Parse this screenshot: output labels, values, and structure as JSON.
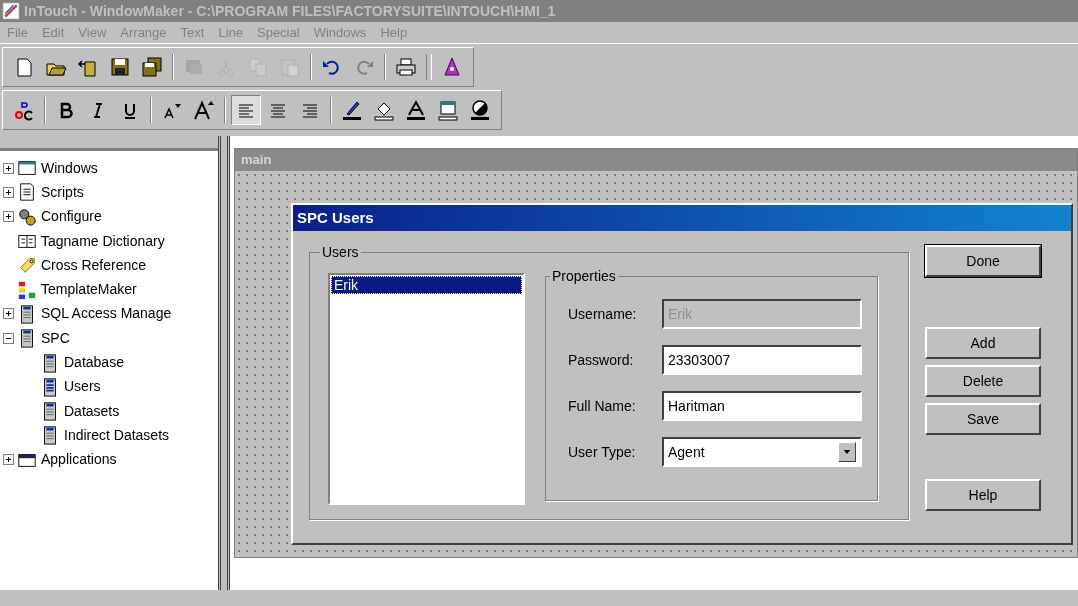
{
  "window": {
    "title": "InTouch - WindowMaker - C:\\PROGRAM FILES\\FACTORYSUITE\\INTOUCH\\HMI_1",
    "active": false
  },
  "menu": [
    "File",
    "Edit",
    "View",
    "Arrange",
    "Text",
    "Line",
    "Special",
    "Windows",
    "Help"
  ],
  "toolbar_1": [
    {
      "disabled": false
    },
    {
      "disabled": false
    },
    {
      "disabled": false
    },
    {
      "disabled": false
    },
    {
      "disabled": false
    },
    {
      "disabled": true
    },
    {
      "disabled": true
    },
    {
      "disabled": true
    },
    {
      "disabled": true
    },
    {
      "disabled": false
    },
    {
      "disabled": true
    },
    {
      "disabled": false
    },
    {
      "disabled": false
    }
  ],
  "toolbar_2": [
    {
      "selected": false
    },
    {
      "selected": false
    },
    {
      "selected": false
    },
    {
      "selected": false
    },
    {
      "selected": false
    },
    {
      "selected": false
    },
    {
      "selected": true
    },
    {
      "selected": false
    },
    {
      "selected": false
    },
    {
      "selected": false
    },
    {
      "selected": false
    },
    {
      "selected": false
    },
    {
      "selected": false
    },
    {
      "selected": false
    }
  ],
  "tree": [
    {
      "label": "Windows",
      "expanded": false
    },
    {
      "label": "Scripts",
      "expanded": false
    },
    {
      "label": "Configure",
      "expanded": false
    },
    {
      "label": "Tagname Dictionary"
    },
    {
      "label": "Cross Reference"
    },
    {
      "label": "TemplateMaker"
    },
    {
      "label": "SQL Access Manage",
      "expanded": false
    },
    {
      "label": "SPC",
      "expanded": true,
      "children": [
        {
          "label": "Database"
        },
        {
          "label": "Users"
        },
        {
          "label": "Datasets"
        },
        {
          "label": "Indirect Datasets"
        }
      ]
    },
    {
      "label": "Applications",
      "expanded": false
    }
  ],
  "document_window": {
    "title": "main"
  },
  "dialog": {
    "title": "SPC Users",
    "users_group": {
      "legend": "Users",
      "users": [
        {
          "label": "Erik",
          "selected": true
        }
      ]
    },
    "properties_group": {
      "legend": "Properties",
      "fields": [
        {
          "kind": "text",
          "label": "Username:",
          "value": "Erik",
          "disabled": true
        },
        {
          "kind": "text",
          "label": "Password:",
          "value": "23303007",
          "disabled": false
        },
        {
          "kind": "text",
          "label": "Full Name:",
          "value": "Haritman",
          "disabled": false
        },
        {
          "kind": "dropdown",
          "label": "User Type:",
          "value": "Agent",
          "disabled": false
        }
      ]
    },
    "button_groups": [
      {
        "buttons": [
          {
            "label": "Done",
            "default": true
          }
        ]
      },
      {
        "buttons": [
          {
            "label": "Add",
            "default": false
          },
          {
            "label": "Delete",
            "default": false
          },
          {
            "label": "Save",
            "default": false
          }
        ]
      },
      {
        "buttons": [
          {
            "label": "Help",
            "default": false
          }
        ]
      }
    ]
  }
}
